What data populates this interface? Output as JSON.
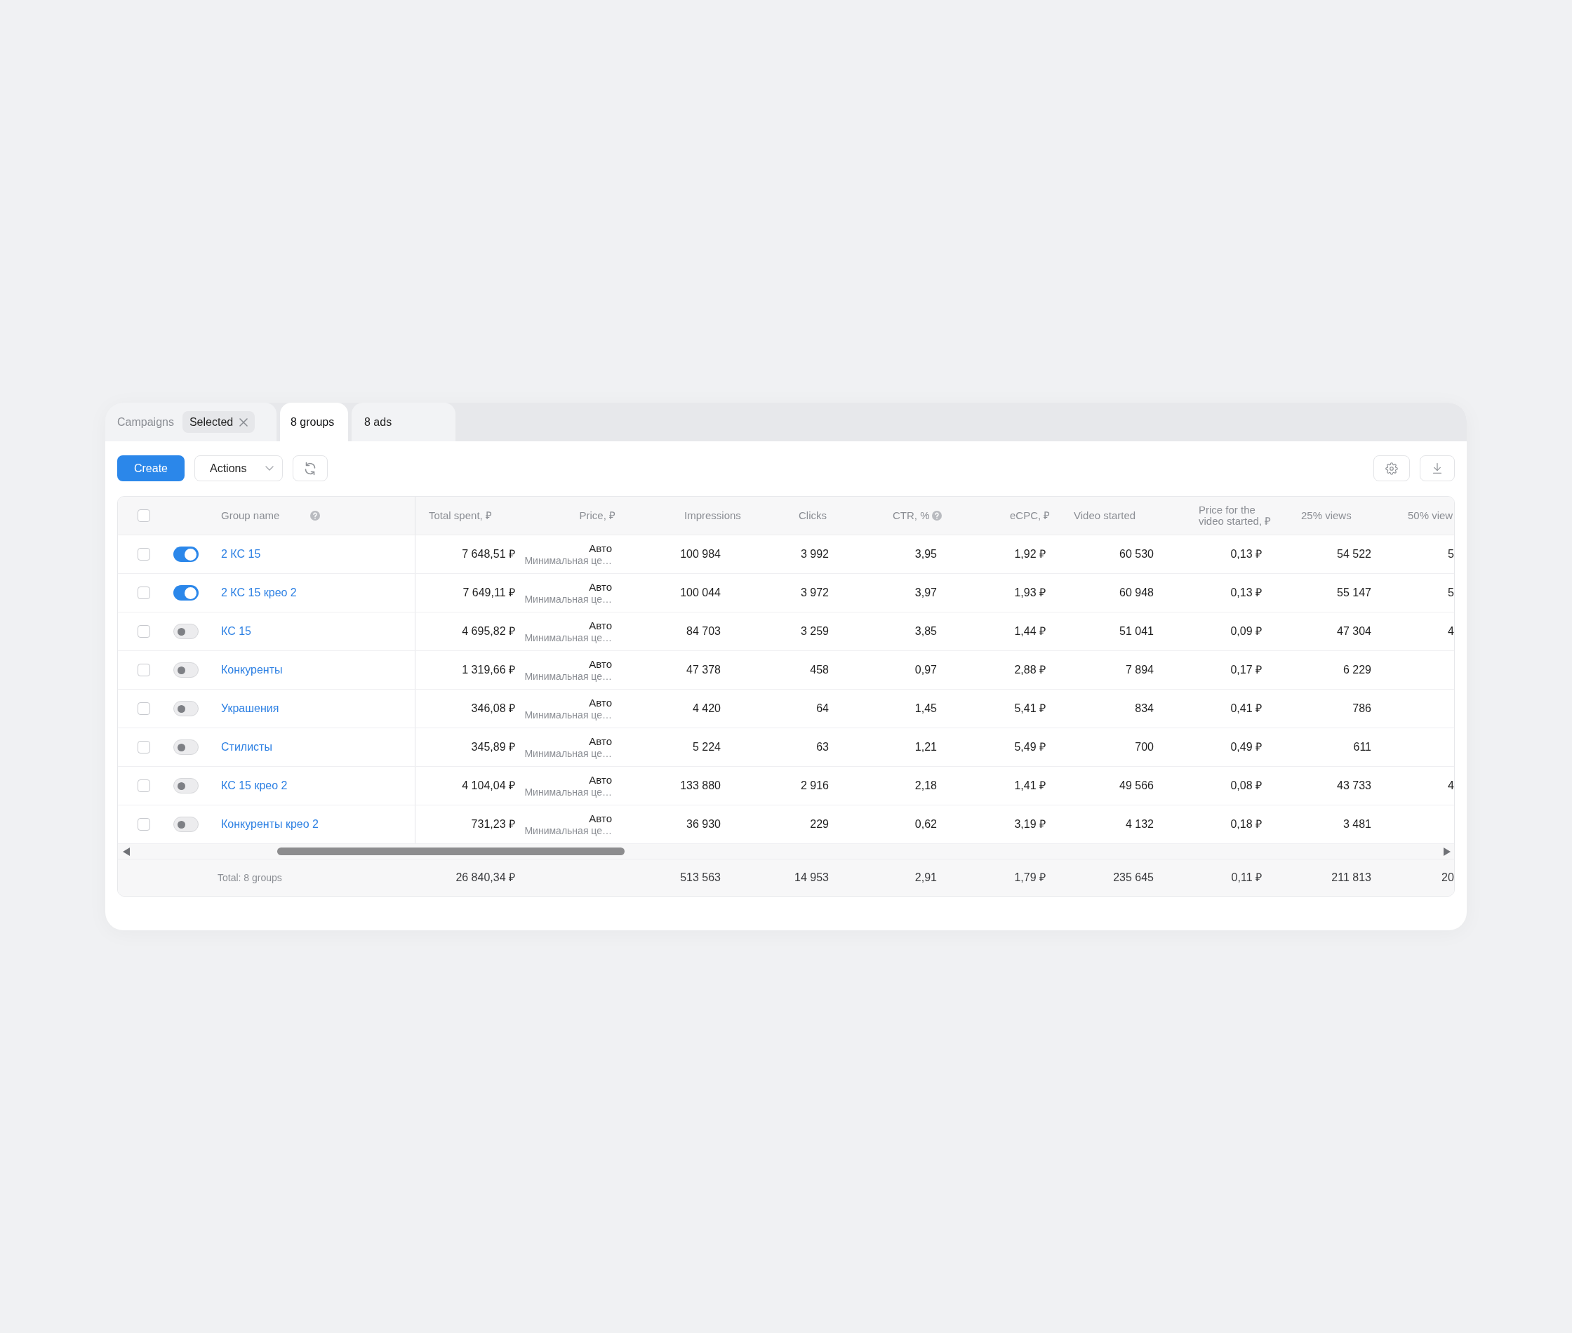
{
  "tabs": [
    {
      "label": "Campaigns",
      "selected": false,
      "filter": {
        "label": "Selected"
      }
    },
    {
      "label": "8 groups",
      "selected": true
    },
    {
      "label": "8 ads",
      "selected": false
    }
  ],
  "toolbar": {
    "create": "Create",
    "actions": "Actions"
  },
  "table": {
    "select_all": {
      "checked": false
    },
    "columns": [
      {
        "label": "Group name",
        "help": true
      },
      {
        "label": "Total spent, ₽"
      },
      {
        "label": "Price, ₽"
      },
      {
        "label": "Impressions"
      },
      {
        "label": "Clicks"
      },
      {
        "label": "CTR, %",
        "help": true
      },
      {
        "label": "eCPC, ₽"
      },
      {
        "label": "Video started"
      },
      {
        "label": "Price for the video started, ₽"
      },
      {
        "label": "25% views"
      },
      {
        "label": "50% view"
      }
    ],
    "rows": [
      {
        "checked": false,
        "enabled": true,
        "name": "2 КС 15",
        "total_spent": "7 648,51 ₽",
        "price": {
          "mode": "Авто",
          "note": "Минимальная це…"
        },
        "metrics": [
          "100 984",
          "3 992",
          "3,95",
          "1,92 ₽",
          "60 530",
          "0,13 ₽",
          "54 522",
          "5"
        ]
      },
      {
        "checked": false,
        "enabled": true,
        "name": "2 КС 15 крео 2",
        "total_spent": "7 649,11 ₽",
        "price": {
          "mode": "Авто",
          "note": "Минимальная це…"
        },
        "metrics": [
          "100 044",
          "3 972",
          "3,97",
          "1,93 ₽",
          "60 948",
          "0,13 ₽",
          "55 147",
          "5"
        ]
      },
      {
        "checked": false,
        "enabled": false,
        "name": "КС 15",
        "total_spent": "4 695,82 ₽",
        "price": {
          "mode": "Авто",
          "note": "Минимальная це…"
        },
        "metrics": [
          "84 703",
          "3 259",
          "3,85",
          "1,44 ₽",
          "51 041",
          "0,09 ₽",
          "47 304",
          "4"
        ]
      },
      {
        "checked": false,
        "enabled": false,
        "name": "Конкуренты",
        "total_spent": "1 319,66 ₽",
        "price": {
          "mode": "Авто",
          "note": "Минимальная це…"
        },
        "metrics": [
          "47 378",
          "458",
          "0,97",
          "2,88 ₽",
          "7 894",
          "0,17 ₽",
          "6 229"
        ]
      },
      {
        "checked": false,
        "enabled": false,
        "name": "Украшения",
        "total_spent": "346,08 ₽",
        "price": {
          "mode": "Авто",
          "note": "Минимальная це…"
        },
        "metrics": [
          "4 420",
          "64",
          "1,45",
          "5,41 ₽",
          "834",
          "0,41 ₽",
          "786"
        ]
      },
      {
        "checked": false,
        "enabled": false,
        "name": "Стилисты",
        "total_spent": "345,89 ₽",
        "price": {
          "mode": "Авто",
          "note": "Минимальная це…"
        },
        "metrics": [
          "5 224",
          "63",
          "1,21",
          "5,49 ₽",
          "700",
          "0,49 ₽",
          "611"
        ]
      },
      {
        "checked": false,
        "enabled": false,
        "name": "КС 15 крео 2",
        "total_spent": "4 104,04 ₽",
        "price": {
          "mode": "Авто",
          "note": "Минимальная це…"
        },
        "metrics": [
          "133 880",
          "2 916",
          "2,18",
          "1,41 ₽",
          "49 566",
          "0,08 ₽",
          "43 733",
          "4"
        ]
      },
      {
        "checked": false,
        "enabled": false,
        "name": "Конкуренты крео 2",
        "total_spent": "731,23 ₽",
        "price": {
          "mode": "Авто",
          "note": "Минимальная це…"
        },
        "metrics": [
          "36 930",
          "229",
          "0,62",
          "3,19 ₽",
          "4 132",
          "0,18 ₽",
          "3 481"
        ]
      }
    ],
    "footer": {
      "label": "Total: 8 groups",
      "total_spent": "26 840,34 ₽",
      "metrics": [
        "513 563",
        "14 953",
        "2,91",
        "1,79 ₽",
        "235 645",
        "0,11 ₽",
        "211 813",
        "20"
      ]
    }
  }
}
